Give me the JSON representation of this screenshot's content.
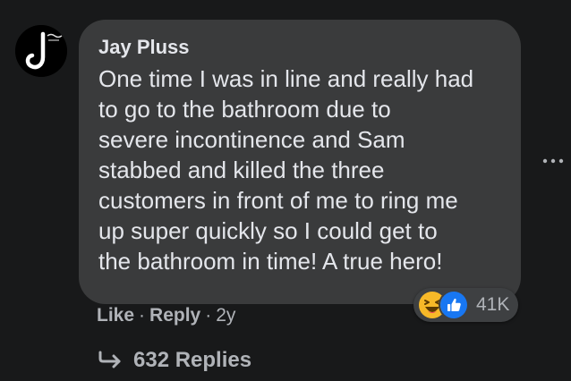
{
  "comment": {
    "author": "Jay Pluss",
    "text": "One time I was in line and really had\nto go to the bathroom due to\nsevere incontinence and Sam\nstabbed and killed the three\ncustomers in front of me to ring me\nup super quickly so I could get to\nthe bathroom in time! A true hero!",
    "reactions": {
      "icons": [
        "haha-icon",
        "like-icon"
      ],
      "count": "41K"
    },
    "actions": {
      "like_label": "Like",
      "separator": "·",
      "reply_label": "Reply",
      "time": "2y"
    },
    "replies_label": "632 Replies"
  },
  "colors": {
    "background": "#18191a",
    "bubble": "#3a3b3c",
    "text_primary": "#e4e6eb",
    "text_secondary": "#b0b3b8",
    "like_blue": "#1877f2",
    "haha_yellow": "#f7b928"
  }
}
